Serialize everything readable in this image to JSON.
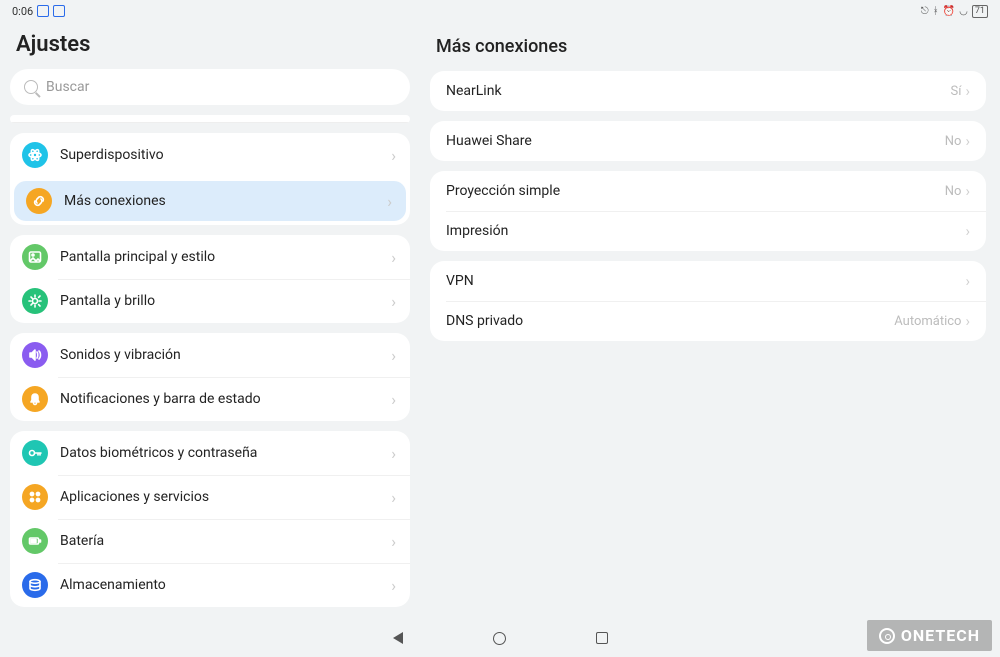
{
  "status": {
    "time": "0:06",
    "battery": "71"
  },
  "left": {
    "title": "Ajustes",
    "search_placeholder": "Buscar",
    "groups": [
      {
        "items": [
          {
            "key": "superdispositivo",
            "label": "Superdispositivo",
            "icon": "atom",
            "color": "c-cyan",
            "selected": false
          },
          {
            "key": "mas-conexiones",
            "label": "Más conexiones",
            "icon": "link",
            "color": "c-orange",
            "selected": true
          }
        ]
      },
      {
        "items": [
          {
            "key": "pantalla-estilo",
            "label": "Pantalla principal y estilo",
            "icon": "image",
            "color": "c-green",
            "selected": false
          },
          {
            "key": "pantalla-brillo",
            "label": "Pantalla y brillo",
            "icon": "sun",
            "color": "c-greenb",
            "selected": false
          }
        ]
      },
      {
        "items": [
          {
            "key": "sonidos",
            "label": "Sonidos y vibración",
            "icon": "speaker",
            "color": "c-purple",
            "selected": false
          },
          {
            "key": "notificaciones",
            "label": "Notificaciones y barra de estado",
            "icon": "bell",
            "color": "c-gold",
            "selected": false
          }
        ]
      },
      {
        "items": [
          {
            "key": "biometria",
            "label": "Datos biométricos y contraseña",
            "icon": "key",
            "color": "c-teal",
            "selected": false
          },
          {
            "key": "apps",
            "label": "Aplicaciones y servicios",
            "icon": "grid",
            "color": "c-amber",
            "selected": false
          },
          {
            "key": "bateria",
            "label": "Batería",
            "icon": "battery",
            "color": "c-green",
            "selected": false
          },
          {
            "key": "almacenamiento",
            "label": "Almacenamiento",
            "icon": "storage",
            "color": "c-blue",
            "selected": false
          }
        ]
      }
    ]
  },
  "right": {
    "title": "Más conexiones",
    "groups": [
      {
        "items": [
          {
            "key": "nearlink",
            "label": "NearLink",
            "value": "Sí"
          }
        ]
      },
      {
        "items": [
          {
            "key": "huawei-share",
            "label": "Huawei Share",
            "value": "No"
          }
        ]
      },
      {
        "items": [
          {
            "key": "proyeccion",
            "label": "Proyección simple",
            "value": "No"
          },
          {
            "key": "impresion",
            "label": "Impresión",
            "value": ""
          }
        ]
      },
      {
        "items": [
          {
            "key": "vpn",
            "label": "VPN",
            "value": ""
          },
          {
            "key": "dns",
            "label": "DNS privado",
            "value": "Automático"
          }
        ]
      }
    ]
  },
  "watermark": "ONETECH"
}
